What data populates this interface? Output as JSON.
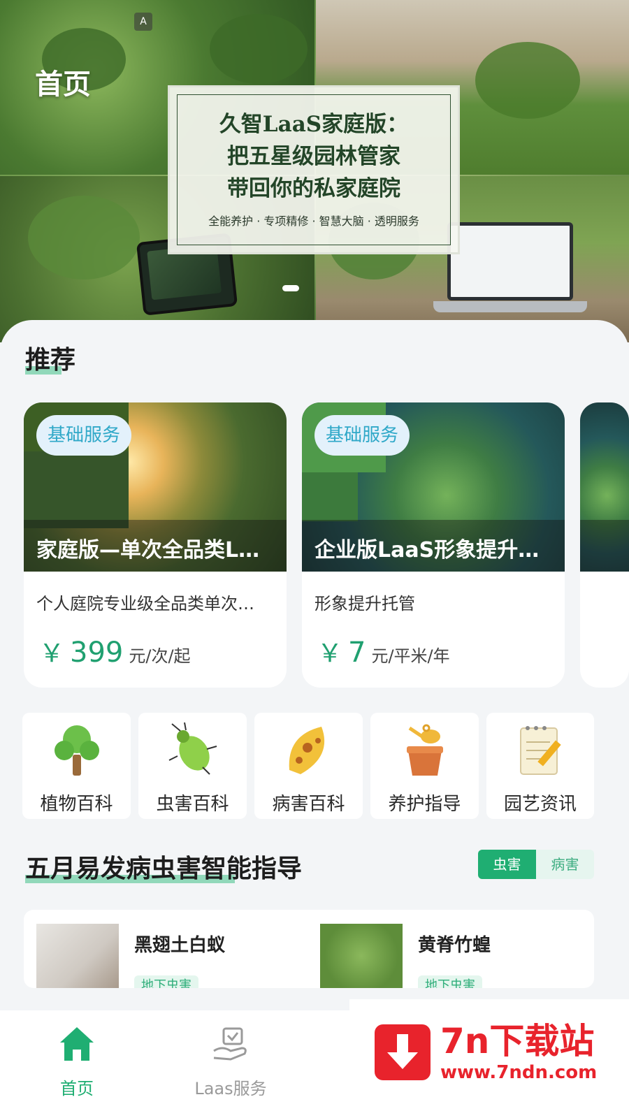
{
  "header": {
    "title": "首页"
  },
  "banner": {
    "title_lines": [
      "久智LaaS家庭版：",
      "把五星级园林管家",
      "带回你的私家庭院"
    ],
    "subtitle": "全能养护 · 专项精修 · 智慧大脑 · 透明服务",
    "slide_indicator": "1"
  },
  "recommend": {
    "title": "推荐",
    "cards": [
      {
        "tag": "基础服务",
        "name": "家庭版—单次全品类L…",
        "desc": "个人庭院专业级全品类单次…",
        "currency": "￥",
        "price": "399",
        "unit": "元/次/起"
      },
      {
        "tag": "基础服务",
        "name": "企业版LaaS形象提升…",
        "desc": "形象提升托管",
        "currency": "￥",
        "price": "7",
        "unit": "元/平米/年"
      }
    ]
  },
  "categories": [
    {
      "label": "植物百科",
      "icon": "tree-icon"
    },
    {
      "label": "虫害百科",
      "icon": "beetle-icon"
    },
    {
      "label": "病害百科",
      "icon": "diseased-leaf-icon"
    },
    {
      "label": "养护指导",
      "icon": "watering-pot-icon"
    },
    {
      "label": "园艺资讯",
      "icon": "notepad-pencil-icon"
    }
  ],
  "pests": {
    "title": "五月易发病虫害智能指导",
    "tabs": [
      "虫害",
      "病害"
    ],
    "active_tab": "虫害",
    "items": [
      {
        "name": "黑翅土白蚁",
        "tag": "地下虫害"
      },
      {
        "name": "黄脊竹蝗",
        "tag": "地下虫害"
      }
    ]
  },
  "nav": {
    "items": [
      {
        "label": "首页",
        "icon": "home-icon",
        "active": true
      },
      {
        "label": "Laas服务",
        "icon": "hand-service-icon",
        "active": false
      }
    ],
    "active_color": "#1fae72",
    "inactive_color": "#9a9a9a"
  },
  "watermark": {
    "main": "7n下载站",
    "sub": "www.7ndn.com"
  },
  "colors": {
    "accent": "#1fae72",
    "price": "#20a070",
    "tag_text": "#2fa8c8"
  }
}
